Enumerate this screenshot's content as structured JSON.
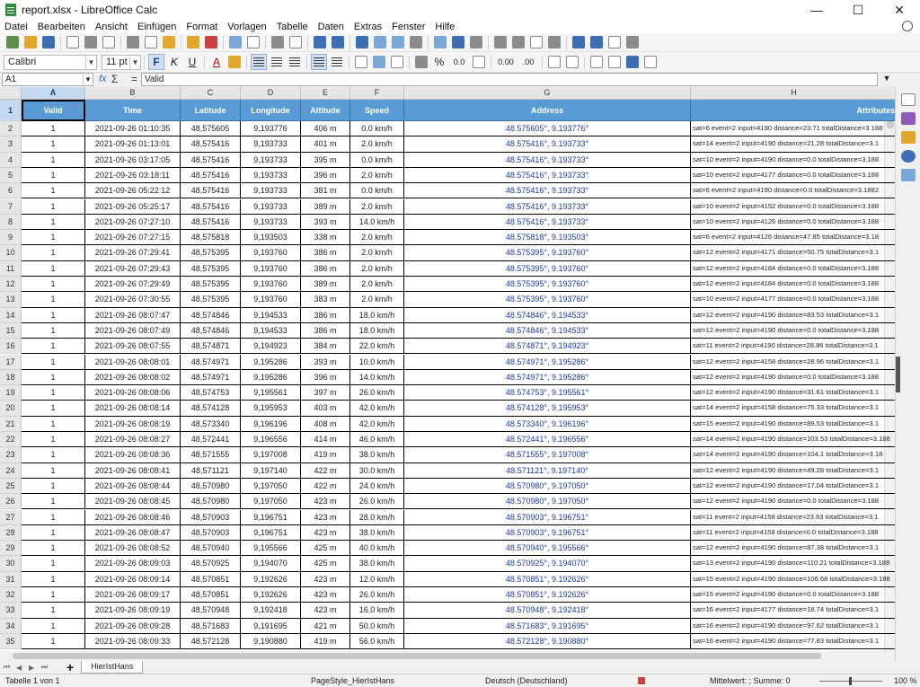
{
  "window": {
    "title": "report.xlsx - LibreOffice Calc",
    "controls": [
      "—",
      "☐",
      "✕"
    ]
  },
  "menu": [
    "Datei",
    "Bearbeiten",
    "Ansicht",
    "Einfügen",
    "Format",
    "Vorlagen",
    "Tabelle",
    "Daten",
    "Extras",
    "Fenster",
    "Hilfe"
  ],
  "font": {
    "name": "Calibri",
    "size": "11 pt"
  },
  "format_buttons": {
    "bold": "F",
    "italic": "K",
    "underline": "U"
  },
  "number_format_symbols": [
    "%",
    "0.0",
    "0.00",
    ".00"
  ],
  "formula": {
    "cell_ref": "A1",
    "fx": "fx",
    "sigma": "Σ",
    "equals": "=",
    "value": "Valid"
  },
  "columns": [
    "A",
    "B",
    "C",
    "D",
    "E",
    "F",
    "G",
    "H"
  ],
  "header_row": {
    "row": "1",
    "cells": [
      "Valid",
      "Time",
      "Latitude",
      "Longitude",
      "Altitude",
      "Speed",
      "Address",
      "Attributes"
    ]
  },
  "rows": [
    {
      "n": "2",
      "cells": [
        "1",
        "2021-09-26 01:10:35",
        "48,575605",
        "9,193776",
        "406 m",
        "0.0 km/h",
        "48.575605°, 9.193776°",
        "sat=6 event=2 input=4190 distance=23.71 totalDistance=3.188"
      ]
    },
    {
      "n": "3",
      "cells": [
        "1",
        "2021-09-26 01:13:01",
        "48,575416",
        "9,193733",
        "401 m",
        "2.0 km/h",
        "48.575416°, 9.193733°",
        "sat=14 event=2 input=4190 distance=21.28 totalDistance=3.1"
      ]
    },
    {
      "n": "4",
      "cells": [
        "1",
        "2021-09-26 03:17:05",
        "48,575416",
        "9,193733",
        "395 m",
        "0.0 km/h",
        "48.575416°, 9.193733°",
        "sat=10 event=2 input=4190 distance=0.0 totalDistance=3.188"
      ]
    },
    {
      "n": "5",
      "cells": [
        "1",
        "2021-09-26 03:18:11",
        "48,575416",
        "9,193733",
        "396 m",
        "2.0 km/h",
        "48.575416°, 9.193733°",
        "sat=10 event=2 input=4177 distance=0.0 totalDistance=3.188"
      ]
    },
    {
      "n": "6",
      "cells": [
        "1",
        "2021-09-26 05:22:12",
        "48,575416",
        "9,193733",
        "381 m",
        "0.0 km/h",
        "48.575416°, 9.193733°",
        "sat=6 event=2 input=4190 distance=0.0 totalDistance=3.1882"
      ]
    },
    {
      "n": "7",
      "cells": [
        "1",
        "2021-09-26 05:25:17",
        "48,575416",
        "9,193733",
        "389 m",
        "2.0 km/h",
        "48.575416°, 9.193733°",
        "sat=10 event=2 input=4152 distance=0.0 totalDistance=3.188"
      ]
    },
    {
      "n": "8",
      "cells": [
        "1",
        "2021-09-26 07:27:10",
        "48,575416",
        "9,193733",
        "393 m",
        "14.0 km/h",
        "48.575416°, 9.193733°",
        "sat=10 event=2 input=4126 distance=0.0 totalDistance=3.188"
      ]
    },
    {
      "n": "9",
      "cells": [
        "1",
        "2021-09-26 07:27:15",
        "48,575818",
        "9,193503",
        "338 m",
        "2.0 km/h",
        "48.575818°, 9.193503°",
        "sat=6 event=2 input=4126 distance=47.85 totalDistance=3.18"
      ]
    },
    {
      "n": "10",
      "cells": [
        "1",
        "2021-09-26 07:29:41",
        "48,575395",
        "9,193760",
        "386 m",
        "2.0 km/h",
        "48.575395°, 9.193760°",
        "sat=12 event=2 input=4171 distance=50.75 totalDistance=3.1"
      ]
    },
    {
      "n": "11",
      "cells": [
        "1",
        "2021-09-26 07:29:43",
        "48,575395",
        "9,193760",
        "386 m",
        "2.0 km/h",
        "48.575395°, 9.193760°",
        "sat=12 event=2 input=4184 distance=0.0 totalDistance=3.188"
      ]
    },
    {
      "n": "12",
      "cells": [
        "1",
        "2021-09-26 07:29:49",
        "48,575395",
        "9,193760",
        "389 m",
        "2.0 km/h",
        "48.575395°, 9.193760°",
        "sat=12 event=2 input=4184 distance=0.0 totalDistance=3.188"
      ]
    },
    {
      "n": "13",
      "cells": [
        "1",
        "2021-09-26 07:30:55",
        "48,575395",
        "9,193760",
        "383 m",
        "2.0 km/h",
        "48.575395°, 9.193760°",
        "sat=10 event=2 input=4177 distance=0.0 totalDistance=3.188"
      ]
    },
    {
      "n": "14",
      "cells": [
        "1",
        "2021-09-26 08:07:47",
        "48,574846",
        "9,194533",
        "386 m",
        "18.0 km/h",
        "48.574846°, 9.194533°",
        "sat=12 event=2 input=4190 distance=83.53 totalDistance=3.1"
      ]
    },
    {
      "n": "15",
      "cells": [
        "1",
        "2021-09-26 08:07:49",
        "48,574846",
        "9,194533",
        "386 m",
        "18.0 km/h",
        "48.574846°, 9.194533°",
        "sat=12 event=2 input=4190 distance=0.0 totalDistance=3.188"
      ]
    },
    {
      "n": "16",
      "cells": [
        "1",
        "2021-09-26 08:07:55",
        "48,574871",
        "9,194923",
        "384 m",
        "22.0 km/h",
        "48.574871°, 9.194923°",
        "sat=11 event=2 input=4190 distance=28.86 totalDistance=3.1"
      ]
    },
    {
      "n": "17",
      "cells": [
        "1",
        "2021-09-26 08:08:01",
        "48,574971",
        "9,195286",
        "393 m",
        "10.0 km/h",
        "48.574971°, 9.195286°",
        "sat=12 event=2 input=4158 distance=28.96 totalDistance=3.1"
      ]
    },
    {
      "n": "18",
      "cells": [
        "1",
        "2021-09-26 08:08:02",
        "48,574971",
        "9,195286",
        "396 m",
        "14.0 km/h",
        "48.574971°, 9.195286°",
        "sat=12 event=2 input=4190 distance=0.0 totalDistance=3.188"
      ]
    },
    {
      "n": "19",
      "cells": [
        "1",
        "2021-09-26 08:08:06",
        "48,574753",
        "9,195561",
        "397 m",
        "26.0 km/h",
        "48.574753°, 9.195561°",
        "sat=12 event=2 input=4190 distance=31.61 totalDistance=3.1"
      ]
    },
    {
      "n": "20",
      "cells": [
        "1",
        "2021-09-26 08:08:14",
        "48,574128",
        "9,195953",
        "403 m",
        "42.0 km/h",
        "48.574128°, 9.195953°",
        "sat=14 event=2 input=4158 distance=75.33 totalDistance=3.1"
      ]
    },
    {
      "n": "21",
      "cells": [
        "1",
        "2021-09-26 08:08:19",
        "48,573340",
        "9,196196",
        "408 m",
        "42.0 km/h",
        "48.573340°, 9.196196°",
        "sat=15 event=2 input=4190 distance=89.53 totalDistance=3.1"
      ]
    },
    {
      "n": "22",
      "cells": [
        "1",
        "2021-09-26 08:08:27",
        "48,572441",
        "9,196556",
        "414 m",
        "46.0 km/h",
        "48.572441°, 9.196556°",
        "sat=14 event=2 input=4190 distance=103.53 totalDistance=3.188"
      ]
    },
    {
      "n": "23",
      "cells": [
        "1",
        "2021-09-26 08:08:36",
        "48,571555",
        "9,197008",
        "419 m",
        "38.0 km/h",
        "48.571555°, 9.197008°",
        "sat=14 event=2 input=4190 distance=104.1 totalDistance=3.18"
      ]
    },
    {
      "n": "24",
      "cells": [
        "1",
        "2021-09-26 08:08:41",
        "48,571121",
        "9,197140",
        "422 m",
        "30.0 km/h",
        "48.571121°, 9.197140°",
        "sat=12 event=2 input=4190 distance=49.28 totalDistance=3.1"
      ]
    },
    {
      "n": "25",
      "cells": [
        "1",
        "2021-09-26 08:08:44",
        "48,570980",
        "9,197050",
        "422 m",
        "24.0 km/h",
        "48.570980°, 9.197050°",
        "sat=12 event=2 input=4190 distance=17.04 totalDistance=3.1"
      ]
    },
    {
      "n": "26",
      "cells": [
        "1",
        "2021-09-26 08:08:45",
        "48,570980",
        "9,197050",
        "423 m",
        "26.0 km/h",
        "48.570980°, 9.197050°",
        "sat=12 event=2 input=4190 distance=0.0 totalDistance=3.188"
      ]
    },
    {
      "n": "27",
      "cells": [
        "1",
        "2021-09-26 08:08:46",
        "48,570903",
        "9,196751",
        "423 m",
        "28.0 km/h",
        "48.570903°, 9.196751°",
        "sat=11 event=2 input=4158 distance=23.63 totalDistance=3.1"
      ]
    },
    {
      "n": "28",
      "cells": [
        "1",
        "2021-09-26 08:08:47",
        "48,570903",
        "9,196751",
        "423 m",
        "38.0 km/h",
        "48.570903°, 9.196751°",
        "sat=11 event=2 input=4158 distance=0.0 totalDistance=3.188"
      ]
    },
    {
      "n": "29",
      "cells": [
        "1",
        "2021-09-26 08:08:52",
        "48,570940",
        "9,195566",
        "425 m",
        "40.0 km/h",
        "48.570940°, 9.195566°",
        "sat=12 event=2 input=4190 distance=87.38 totalDistance=3.1"
      ]
    },
    {
      "n": "30",
      "cells": [
        "1",
        "2021-09-26 08:09:03",
        "48,570925",
        "9,194070",
        "425 m",
        "38.0 km/h",
        "48.570925°, 9.194070°",
        "sat=13 event=2 input=4190 distance=110.21 totalDistance=3.188"
      ]
    },
    {
      "n": "31",
      "cells": [
        "1",
        "2021-09-26 08:09:14",
        "48,570851",
        "9,192626",
        "423 m",
        "12.0 km/h",
        "48.570851°, 9.192626°",
        "sat=15 event=2 input=4190 distance=106.68 totalDistance=3.188"
      ]
    },
    {
      "n": "32",
      "cells": [
        "1",
        "2021-09-26 08:09:17",
        "48,570851",
        "9,192626",
        "423 m",
        "26.0 km/h",
        "48.570851°, 9.192626°",
        "sat=15 event=2 input=4190 distance=0.0 totalDistance=3.188"
      ]
    },
    {
      "n": "33",
      "cells": [
        "1",
        "2021-09-26 08:09:19",
        "48,570948",
        "9,192418",
        "423 m",
        "16.0 km/h",
        "48.570948°, 9.192418°",
        "sat=16 event=2 input=4177 distance=18.74 totalDistance=3.1"
      ]
    },
    {
      "n": "34",
      "cells": [
        "1",
        "2021-09-26 08:09:28",
        "48,571683",
        "9,191695",
        "421 m",
        "50.0 km/h",
        "48.571683°, 9.191695°",
        "sat=16 event=2 input=4190 distance=97.62 totalDistance=3.1"
      ]
    },
    {
      "n": "35",
      "cells": [
        "1",
        "2021-09-26 08:09:33",
        "48,572128",
        "9,190880",
        "419 m",
        "56.0 km/h",
        "48.572128°, 9.190880°",
        "sat=16 event=2 input=4190 distance=77.83 totalDistance=3.1"
      ]
    }
  ],
  "sheet_tabs": [
    "HierIstHans"
  ],
  "status": {
    "sheet_info": "Tabelle 1 von 1",
    "page_style": "PageStyle_HierIstHans",
    "language": "Deutsch (Deutschland)",
    "summary": "Mittelwert: ; Summe: 0",
    "zoom": "100 %"
  }
}
